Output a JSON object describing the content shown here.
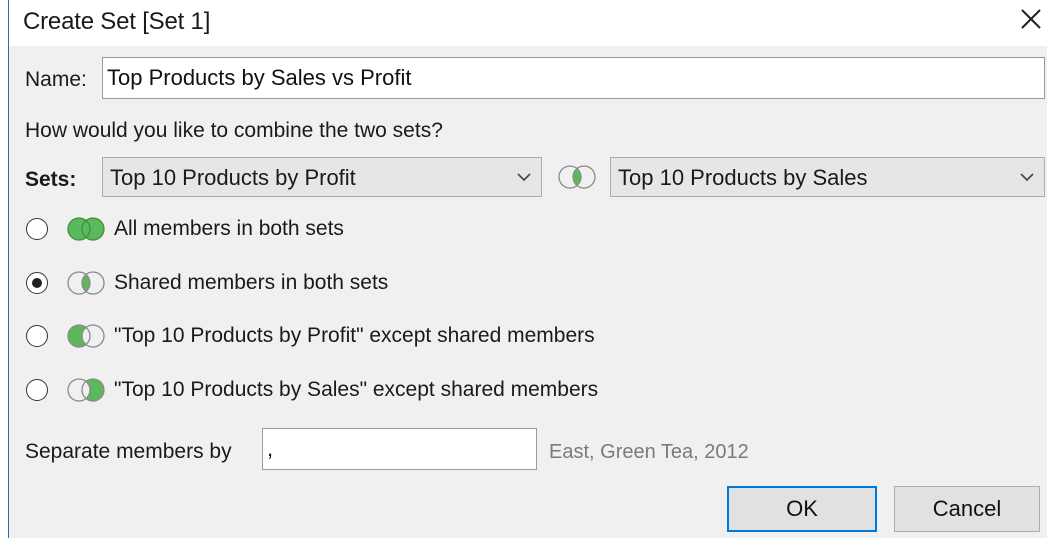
{
  "window": {
    "title": "Create Set [Set 1]",
    "close_icon": "close-icon"
  },
  "name_field": {
    "label": "Name:",
    "value": "Top Products by Sales vs Profit"
  },
  "prompt": "How would you like to combine the two sets?",
  "sets": {
    "label": "Sets:",
    "left_set": "Top 10 Products by Profit",
    "right_set": "Top 10 Products by Sales",
    "combine_icon": "venn-intersection-icon"
  },
  "options": [
    {
      "label": "All members in both sets",
      "selected": false,
      "icon": "venn-union-icon"
    },
    {
      "label": "Shared members in both sets",
      "selected": true,
      "icon": "venn-intersection-icon"
    },
    {
      "label": "\"Top 10 Products by Profit\" except shared members",
      "selected": false,
      "icon": "venn-left-only-icon"
    },
    {
      "label": "\"Top 10 Products by Sales\" except shared members",
      "selected": false,
      "icon": "venn-right-only-icon"
    }
  ],
  "separator": {
    "label": "Separate members by",
    "value": ",",
    "example": "East, Green Tea, 2012"
  },
  "buttons": {
    "ok": "OK",
    "cancel": "Cancel"
  },
  "colors": {
    "venn_fill": "#5cb85c",
    "accent_border": "#0078d7"
  }
}
